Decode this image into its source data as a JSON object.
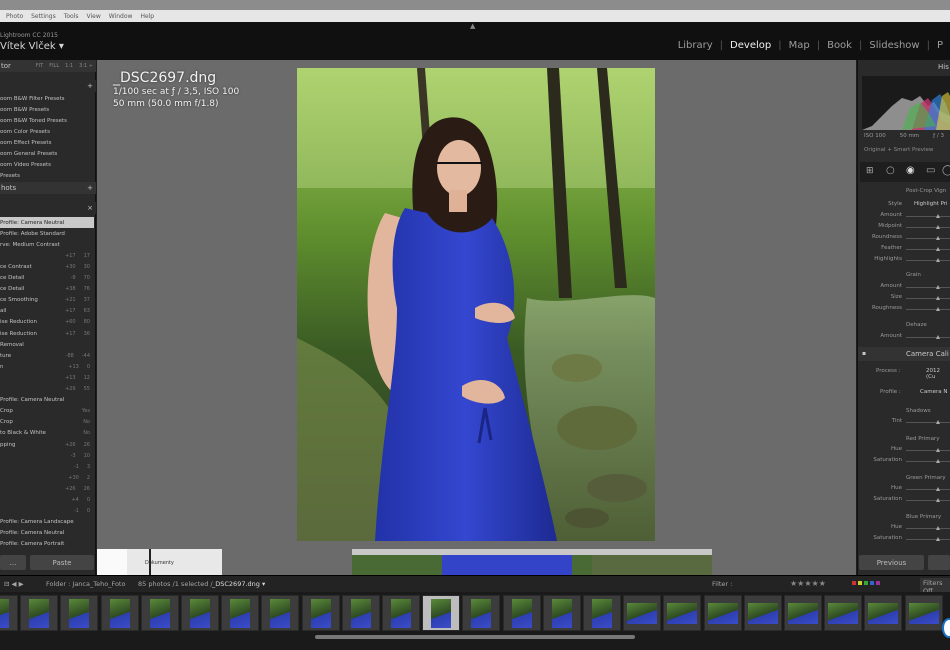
{
  "menu": [
    "Photo",
    "Settings",
    "Tools",
    "View",
    "Window",
    "Help"
  ],
  "identity": {
    "version": "Lightroom CC 2015",
    "user": "Vítek Vlček ▾"
  },
  "modules": [
    {
      "label": "Library",
      "active": false
    },
    {
      "label": "Develop",
      "active": true
    },
    {
      "label": "Map",
      "active": false
    },
    {
      "label": "Book",
      "active": false
    },
    {
      "label": "Slideshow",
      "active": false
    },
    {
      "label": "P",
      "active": false
    }
  ],
  "left": {
    "navigator": {
      "title": "tor",
      "buttons": [
        "FIT",
        "FILL",
        "1:1",
        "3:1 ÷"
      ]
    },
    "presets": [
      "oom B&W Filter Presets",
      "oom B&W Presets",
      "oom B&W Toned Presets",
      "oom Color Presets",
      "oom Effect Presets",
      "oom General Presets",
      "oom Video Presets",
      "Presets"
    ],
    "snapshots_title": "hots",
    "history_close": "×",
    "history": [
      {
        "label": "Profile: Camera Neutral",
        "v1": "",
        "v2": "",
        "sel": true
      },
      {
        "label": "Profile: Adobe Standard",
        "v1": "",
        "v2": "",
        "sel": false
      },
      {
        "label": "rve: Medium Contrast",
        "v1": "",
        "v2": "",
        "sel": false
      },
      {
        "label": "",
        "v1": "+17",
        "v2": "17",
        "sel": false
      },
      {
        "label": "ce Contrast",
        "v1": "+30",
        "v2": "30",
        "sel": false
      },
      {
        "label": "ce Detail",
        "v1": "-9",
        "v2": "70",
        "sel": false
      },
      {
        "label": "ce Detail",
        "v1": "+38",
        "v2": "76",
        "sel": false
      },
      {
        "label": "ce Smoothing",
        "v1": "+21",
        "v2": "37",
        "sel": false
      },
      {
        "label": "ail",
        "v1": "+17",
        "v2": "63",
        "sel": false
      },
      {
        "label": "ise Reduction",
        "v1": "+60",
        "v2": "80",
        "sel": false
      },
      {
        "label": "ise Reduction",
        "v1": "+17",
        "v2": "36",
        "sel": false
      },
      {
        "label": "Removal",
        "v1": "",
        "v2": "",
        "sel": false
      },
      {
        "label": "ture",
        "v1": "-88",
        "v2": "-44",
        "sel": false
      },
      {
        "label": "n",
        "v1": "+13",
        "v2": "0",
        "sel": false
      },
      {
        "label": "",
        "v1": "+13",
        "v2": "12",
        "sel": false
      },
      {
        "label": "",
        "v1": "+29",
        "v2": "55",
        "sel": false
      },
      {
        "label": "Profile: Camera Neutral",
        "v1": "",
        "v2": "",
        "sel": false
      },
      {
        "label": "Crop",
        "v1": "",
        "v2": "Yes",
        "sel": false
      },
      {
        "label": "Crop",
        "v1": "",
        "v2": "No",
        "sel": false
      },
      {
        "label": "to Black & White",
        "v1": "",
        "v2": "No",
        "sel": false
      },
      {
        "label": "pping",
        "v1": "+26",
        "v2": "26",
        "sel": false
      },
      {
        "label": "",
        "v1": "-3",
        "v2": "10",
        "sel": false
      },
      {
        "label": "",
        "v1": "-1",
        "v2": "3",
        "sel": false
      },
      {
        "label": "",
        "v1": "+30",
        "v2": "2",
        "sel": false
      },
      {
        "label": "",
        "v1": "+26",
        "v2": "26",
        "sel": false
      },
      {
        "label": "",
        "v1": "+4",
        "v2": "0",
        "sel": false
      },
      {
        "label": "",
        "v1": "-1",
        "v2": "0",
        "sel": false
      },
      {
        "label": "Profile: Camera Landscape",
        "v1": "",
        "v2": "",
        "sel": false
      },
      {
        "label": "Profile: Camera Neutral",
        "v1": "",
        "v2": "",
        "sel": false
      },
      {
        "label": "Profile: Camera Portrait",
        "v1": "",
        "v2": "",
        "sel": false
      }
    ],
    "copy_label": "...",
    "paste_label": "Paste"
  },
  "overlay": {
    "filename": "_DSC2697.dng",
    "exposure": "1/100 sec at ƒ / 3,5, ISO 100",
    "lens": "50 mm (50.0 mm f/1.8)"
  },
  "strip_label": "Dokumenty",
  "right": {
    "histogram_title": "His",
    "hist_meta": [
      "ISO 100",
      "50 mm",
      "ƒ / 3"
    ],
    "preview_mode": "Original + Smart Preview",
    "vignette_title": "Post-Crop Vign",
    "vignette": [
      {
        "label": "Style",
        "value": "Highlight Pri"
      },
      {
        "label": "Amount"
      },
      {
        "label": "Midpoint"
      },
      {
        "label": "Roundness"
      },
      {
        "label": "Feather"
      },
      {
        "label": "Highlights"
      }
    ],
    "grain_title": "Grain",
    "grain": [
      "Amount",
      "Size",
      "Roughness"
    ],
    "dehaze_title": "Dehaze",
    "dehaze": [
      "Amount"
    ],
    "calib_title": "Camera Cali",
    "process_label": "Process :",
    "process_value": "2012 (Cu",
    "profile_label": "Profile :",
    "profile_value": "Camera N",
    "shadows_title": "Shadows",
    "shadows": [
      "Tint"
    ],
    "red_title": "Red Primary",
    "green_title": "Green Primary",
    "blue_title": "Blue Primary",
    "primary_rows": [
      "Hue",
      "Saturation"
    ],
    "previous_label": "Previous"
  },
  "filmhdr": {
    "folder": "Folder : Janca_Teho_Foto",
    "count": "85 photos /1 selected /",
    "file": "_DSC2697.dng ▾",
    "filter_label": "Filter :",
    "stars": "★★★★★",
    "filters_off": "Filters Off"
  }
}
